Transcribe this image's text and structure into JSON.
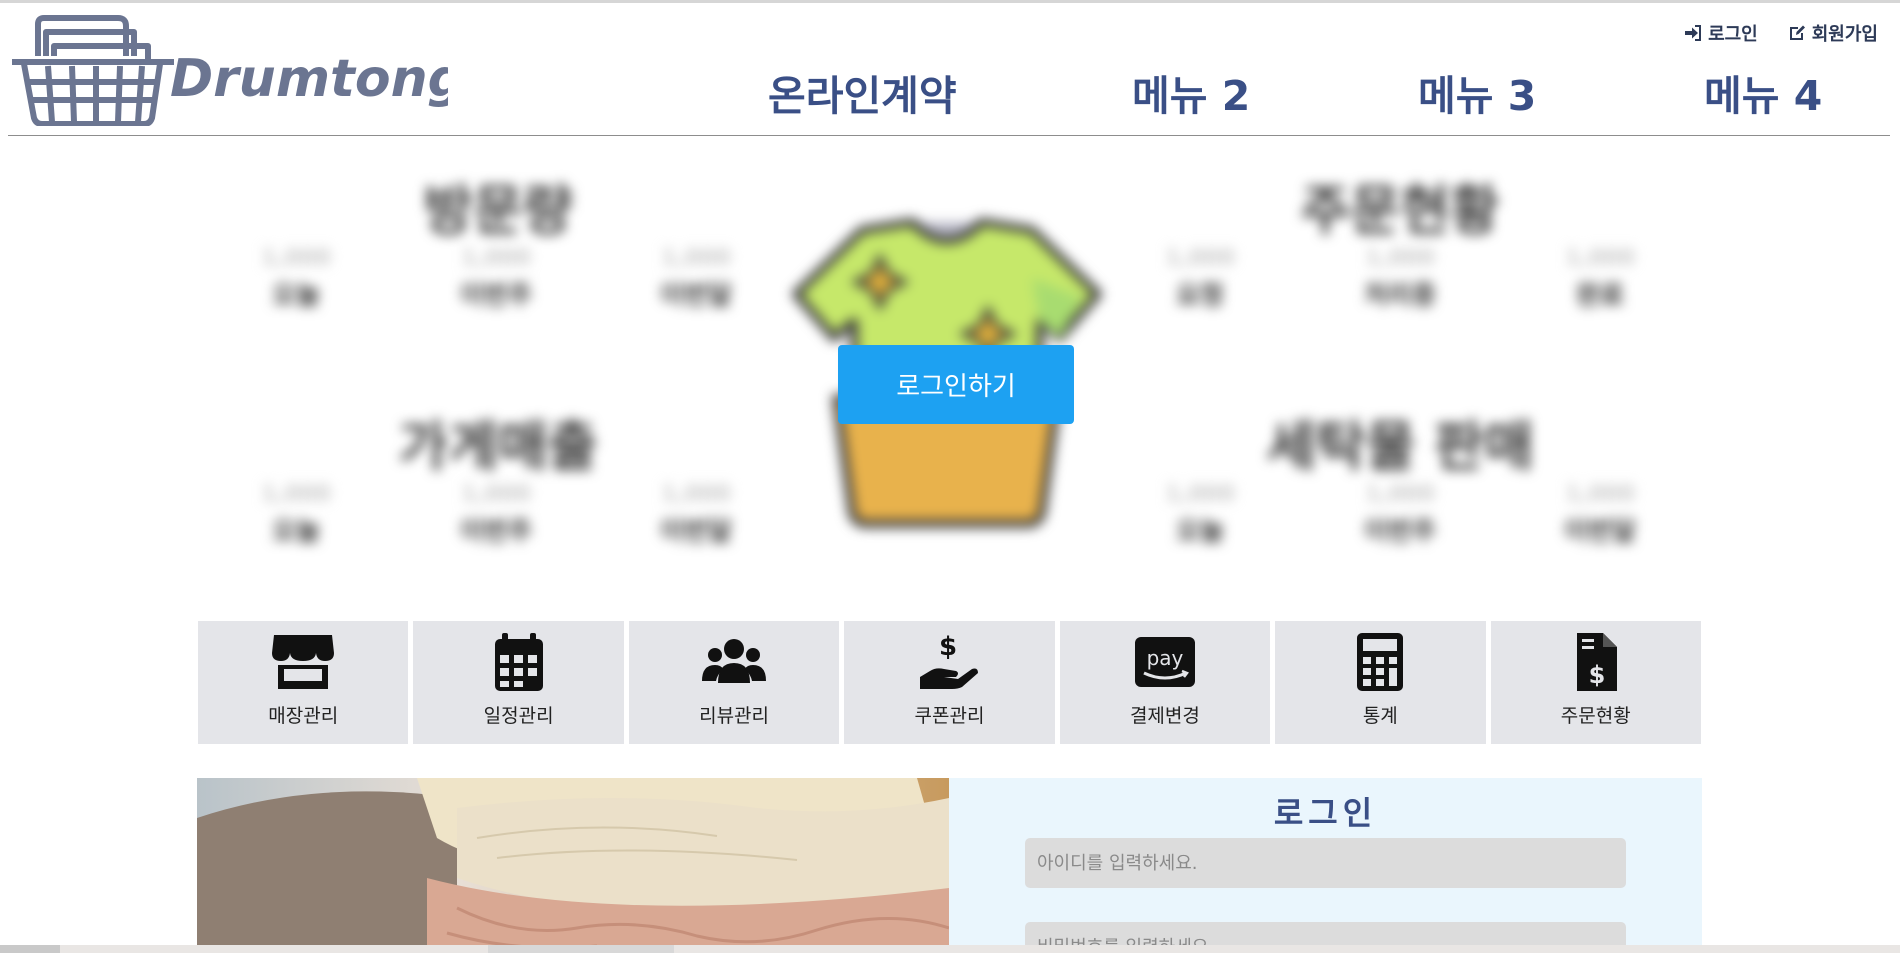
{
  "header": {
    "logo_text": "Drumtong",
    "top_links": [
      {
        "label": "로그인",
        "icon": "sign-in-icon"
      },
      {
        "label": "회원가입",
        "icon": "edit-icon"
      }
    ],
    "nav": [
      "온라인계약",
      "메뉴 2",
      "메뉴 3",
      "메뉴 4"
    ]
  },
  "dashboard": {
    "blocks": [
      {
        "title": "방문량",
        "stats": [
          {
            "value": "1,000",
            "label": "오늘"
          },
          {
            "value": "1,000",
            "label": "이번주"
          },
          {
            "value": "1,000",
            "label": "이번달"
          }
        ]
      },
      {
        "title": "주문현황",
        "stats": [
          {
            "value": "1,000",
            "label": "요청"
          },
          {
            "value": "1,000",
            "label": "처리중"
          },
          {
            "value": "1,000",
            "label": "완료"
          }
        ]
      },
      {
        "title": "가게매출",
        "stats": [
          {
            "value": "1,000",
            "label": "오늘"
          },
          {
            "value": "1,000",
            "label": "이번주"
          },
          {
            "value": "1,000",
            "label": "이번달"
          }
        ]
      },
      {
        "title": "세탁물 판매",
        "stats": [
          {
            "value": "1,000",
            "label": "오늘"
          },
          {
            "value": "1,000",
            "label": "이번주"
          },
          {
            "value": "1,000",
            "label": "이번달"
          }
        ]
      }
    ],
    "login_button": "로그인하기"
  },
  "quick_menu": [
    {
      "label": "매장관리",
      "icon": "store-icon"
    },
    {
      "label": "일정관리",
      "icon": "calendar-icon"
    },
    {
      "label": "리뷰관리",
      "icon": "users-icon"
    },
    {
      "label": "쿠폰관리",
      "icon": "hand-dollar-icon"
    },
    {
      "label": "결제변경",
      "icon": "amazon-pay-icon",
      "icon_text": "pay"
    },
    {
      "label": "통계",
      "icon": "calculator-icon"
    },
    {
      "label": "주문현황",
      "icon": "invoice-dollar-icon"
    }
  ],
  "login_panel": {
    "title": "로그인",
    "id_placeholder": "아이디를 입력하세요.",
    "pw_placeholder": "비밀번호를 입력하세요."
  },
  "colors": {
    "nav_text": "#3a4f86",
    "login_button": "#1da1f2",
    "quick_bg": "#e4e5e9",
    "login_panel_bg": "#eaf6fd"
  }
}
